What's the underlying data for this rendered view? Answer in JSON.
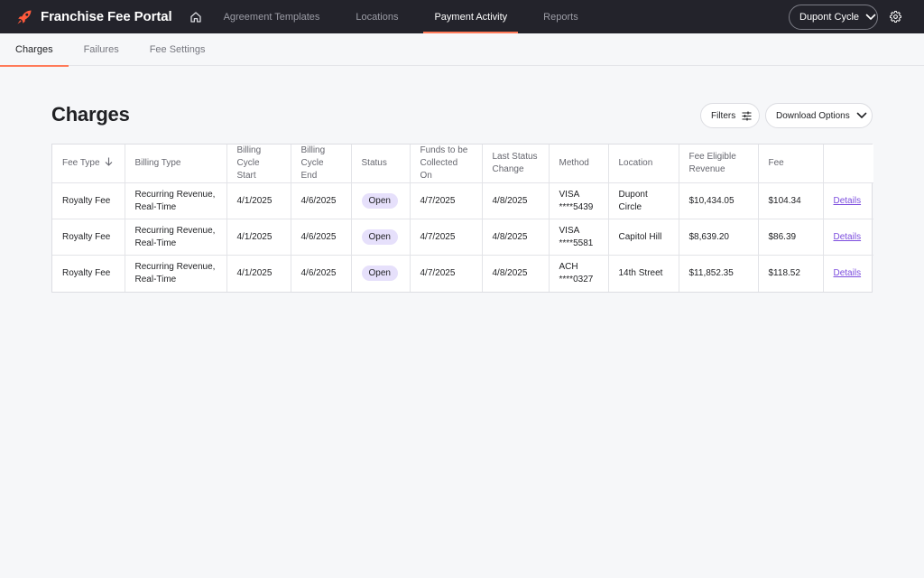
{
  "app": {
    "title": "Franchise Fee Portal",
    "brand_icon": "rocket-icon",
    "accent_color": "#ff7a59"
  },
  "nav": {
    "home_icon": "home-icon",
    "items": [
      {
        "label": "Agreement Templates"
      },
      {
        "label": "Locations"
      },
      {
        "label": "Payment Activity"
      },
      {
        "label": "Reports"
      }
    ],
    "active": "Payment Activity",
    "location_select": "Dupont Cycle",
    "settings_icon": "gear-icon"
  },
  "subtabs": {
    "items": [
      {
        "label": "Charges"
      },
      {
        "label": "Failures"
      },
      {
        "label": "Fee Settings"
      }
    ],
    "active": "Charges"
  },
  "page": {
    "title": "Charges",
    "filters_label": "Filters",
    "download_label": "Download Options"
  },
  "table": {
    "columns": [
      {
        "label": "Fee Type"
      },
      {
        "label": "Billing Type"
      },
      {
        "label": "Billing Cycle Start"
      },
      {
        "label": "Billing Cycle End"
      },
      {
        "label": "Status"
      },
      {
        "label": "Funds to be Collected On"
      },
      {
        "label": "Last Status Change"
      },
      {
        "label": "Method"
      },
      {
        "label": "Location"
      },
      {
        "label": "Fee Eligible Revenue"
      },
      {
        "label": "Fee"
      },
      {
        "label": ""
      }
    ],
    "rows": [
      {
        "fee_type": "Royalty Fee",
        "billing_type": "Recurring Revenue, Real-Time",
        "cycle_start": "4/1/2025",
        "cycle_end": "4/6/2025",
        "status": "Open",
        "collect_on": "4/7/2025",
        "last_change": "4/8/2025",
        "method_type": "VISA",
        "method_number": "****5439",
        "location": "Dupont Circle",
        "revenue": "$10,434.05",
        "fee": "$104.34",
        "action": "Details"
      },
      {
        "fee_type": "Royalty Fee",
        "billing_type": "Recurring Revenue, Real-Time",
        "cycle_start": "4/1/2025",
        "cycle_end": "4/6/2025",
        "status": "Open",
        "collect_on": "4/7/2025",
        "last_change": "4/8/2025",
        "method_type": "VISA",
        "method_number": "****5581",
        "location": "Capitol Hill",
        "revenue": "$8,639.20",
        "fee": "$86.39",
        "action": "Details"
      },
      {
        "fee_type": "Royalty Fee",
        "billing_type": "Recurring Revenue, Real-Time",
        "cycle_start": "4/1/2025",
        "cycle_end": "4/6/2025",
        "status": "Open",
        "collect_on": "4/7/2025",
        "last_change": "4/8/2025",
        "method_type": "ACH",
        "method_number": "****0327",
        "location": "14th Street",
        "revenue": "$11,852.35",
        "fee": "$118.52",
        "action": "Details"
      }
    ]
  }
}
